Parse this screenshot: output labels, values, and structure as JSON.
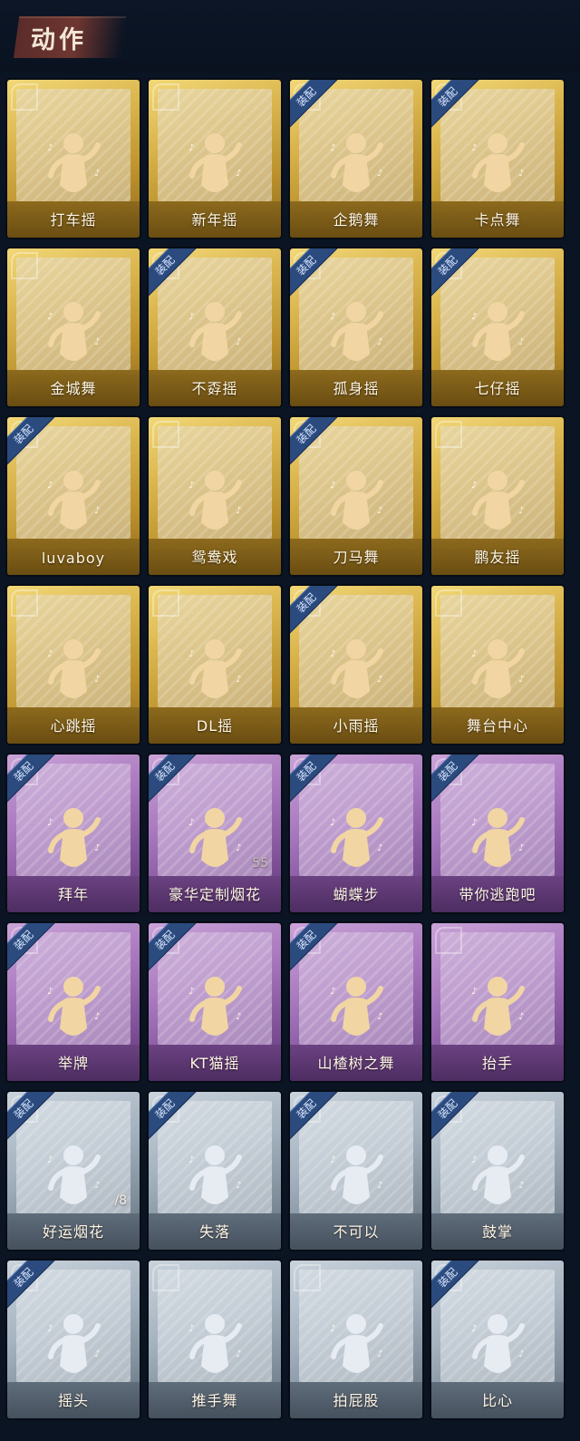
{
  "header": {
    "title": "动作"
  },
  "badge_label": "装配",
  "cards": [
    {
      "label": "打车摇",
      "tier": "gold",
      "equipped": false,
      "icon": "figure-heart-icon"
    },
    {
      "label": "新年摇",
      "tier": "gold",
      "equipped": false,
      "icon": "figure-sway-icon"
    },
    {
      "label": "企鹅舞",
      "tier": "gold",
      "equipped": true,
      "icon": "figure-flap-icon"
    },
    {
      "label": "卡点舞",
      "tier": "gold",
      "equipped": true,
      "icon": "figure-point-up-icon"
    },
    {
      "label": "金城舞",
      "tier": "gold",
      "equipped": false,
      "icon": "figure-wave-icon"
    },
    {
      "label": "不孬摇",
      "tier": "gold",
      "equipped": true,
      "icon": "figure-raise-arm-icon"
    },
    {
      "label": "孤身摇",
      "tier": "gold",
      "equipped": true,
      "icon": "figure-star-icon"
    },
    {
      "label": "七仔摇",
      "tier": "gold",
      "equipped": true,
      "icon": "figure-cross-arm-icon"
    },
    {
      "label": "luvaboy",
      "tier": "gold",
      "equipped": true,
      "icon": "figure-elbow-icon"
    },
    {
      "label": "鸳鸯戏",
      "tier": "gold",
      "equipped": false,
      "icon": "figure-clap-icon"
    },
    {
      "label": "刀马舞",
      "tier": "gold",
      "equipped": true,
      "icon": "figure-twist-icon"
    },
    {
      "label": "鹏友摇",
      "tier": "gold",
      "equipped": false,
      "icon": "figure-arms-wide-icon"
    },
    {
      "label": "心跳摇",
      "tier": "gold",
      "equipped": false,
      "icon": "figure-heartbeat-icon"
    },
    {
      "label": "DL摇",
      "tier": "gold",
      "equipped": false,
      "icon": "figure-v-arms-icon"
    },
    {
      "label": "小雨摇",
      "tier": "gold",
      "equipped": true,
      "icon": "figure-lean-icon"
    },
    {
      "label": "舞台中心",
      "tier": "gold",
      "equipped": false,
      "icon": "figure-center-icon"
    },
    {
      "label": "拜年",
      "tier": "purple",
      "equipped": true,
      "icon": "figure-bow-icon"
    },
    {
      "label": "豪华定制烟花",
      "tier": "purple",
      "equipped": true,
      "icon": "fireworks-icon",
      "count": "55"
    },
    {
      "label": "蝴蝶步",
      "tier": "purple",
      "equipped": true,
      "icon": "figure-butterfly-icon"
    },
    {
      "label": "带你逃跑吧",
      "tier": "purple",
      "equipped": true,
      "icon": "figure-run-icon"
    },
    {
      "label": "举牌",
      "tier": "purple",
      "equipped": true,
      "icon": "figure-sign-icon"
    },
    {
      "label": "KT猫摇",
      "tier": "purple",
      "equipped": true,
      "icon": "figure-cat-icon"
    },
    {
      "label": "山楂树之舞",
      "tier": "purple",
      "equipped": true,
      "icon": "figure-spin-icon"
    },
    {
      "label": "抬手",
      "tier": "purple",
      "equipped": false,
      "icon": "raise-hand-icon"
    },
    {
      "label": "好运烟花",
      "tier": "silver",
      "equipped": true,
      "icon": "firework-can-icon",
      "count": "/8"
    },
    {
      "label": "失落",
      "tier": "silver",
      "equipped": true,
      "icon": "figure-crawl-icon"
    },
    {
      "label": "不可以",
      "tier": "silver",
      "equipped": true,
      "icon": "finger-wag-icon"
    },
    {
      "label": "鼓掌",
      "tier": "silver",
      "equipped": true,
      "icon": "clap-hands-icon"
    },
    {
      "label": "摇头",
      "tier": "silver",
      "equipped": true,
      "icon": "figure-shake-head-icon"
    },
    {
      "label": "推手舞",
      "tier": "silver",
      "equipped": false,
      "icon": "figure-push-icon"
    },
    {
      "label": "拍屁股",
      "tier": "silver",
      "equipped": false,
      "icon": "figure-pat-icon"
    },
    {
      "label": "比心",
      "tier": "silver",
      "equipped": true,
      "icon": "finger-heart-icon"
    }
  ]
}
